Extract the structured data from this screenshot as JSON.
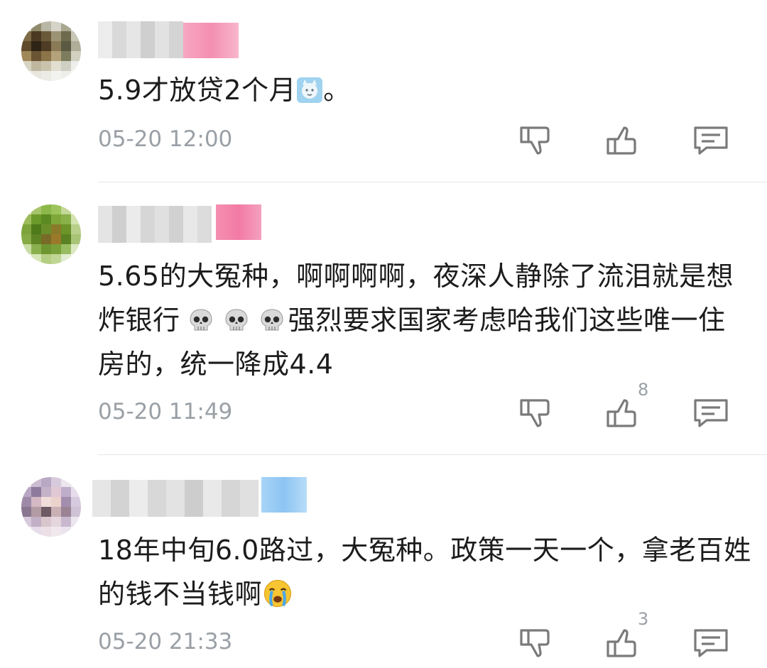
{
  "comments": [
    {
      "text_a": "5.9才放贷2个月",
      "text_b": "。",
      "time": "05-20 12:00",
      "like_count": ""
    },
    {
      "text_a": "5.65的大冤种，啊啊啊啊，夜深人静除了流泪就是想炸银行",
      "text_b": "强烈要求国家考虑哈我们这些唯一住房的，统一降成4.4",
      "time": "05-20 11:49",
      "like_count": "8"
    },
    {
      "text_a": "18年中旬6.0路过，大冤种。政策一天一个，拿老百姓的钱不当钱啊",
      "time": "05-20 21:33",
      "like_count": "3"
    }
  ],
  "icons": [
    "dislike-icon",
    "like-icon",
    "reply-icon"
  ],
  "colors": {
    "time": "#9aa0a6",
    "text": "#1c1c1c",
    "badge_pink": "#f48fb1",
    "badge_blue": "#90caf9"
  }
}
